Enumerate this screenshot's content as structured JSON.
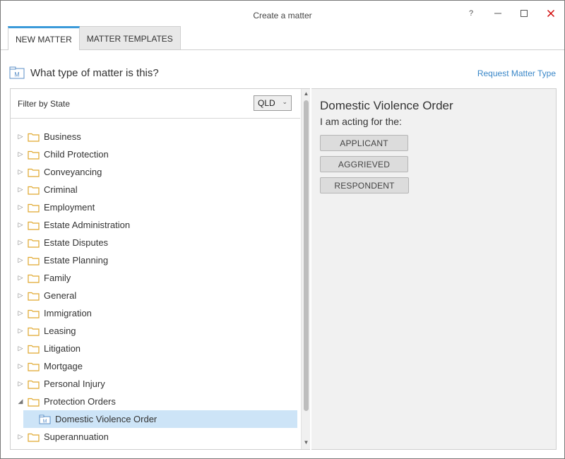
{
  "window": {
    "title": "Create a matter",
    "help_label": "?",
    "minimize_label": "–",
    "maximize_label": "☐",
    "close_label": "✕"
  },
  "tabs": [
    {
      "label": "NEW MATTER",
      "active": true
    },
    {
      "label": "MATTER TEMPLATES",
      "active": false
    }
  ],
  "heading": {
    "text": "What type of matter is this?",
    "icon": "matter-doc-icon",
    "request_link": "Request Matter Type"
  },
  "filter": {
    "label": "Filter by State",
    "state_value": "QLD"
  },
  "tree": [
    {
      "label": "Business",
      "expanded": false
    },
    {
      "label": "Child Protection",
      "expanded": false
    },
    {
      "label": "Conveyancing",
      "expanded": false
    },
    {
      "label": "Criminal",
      "expanded": false
    },
    {
      "label": "Employment",
      "expanded": false
    },
    {
      "label": "Estate Administration",
      "expanded": false
    },
    {
      "label": "Estate Disputes",
      "expanded": false
    },
    {
      "label": "Estate Planning",
      "expanded": false
    },
    {
      "label": "Family",
      "expanded": false
    },
    {
      "label": "General",
      "expanded": false
    },
    {
      "label": "Immigration",
      "expanded": false
    },
    {
      "label": "Leasing",
      "expanded": false
    },
    {
      "label": "Litigation",
      "expanded": false
    },
    {
      "label": "Mortgage",
      "expanded": false
    },
    {
      "label": "Personal Injury",
      "expanded": false
    },
    {
      "label": "Protection Orders",
      "expanded": true
    },
    {
      "label": "Domestic Violence Order",
      "child": true,
      "selected": true
    },
    {
      "label": "Superannuation",
      "expanded": false
    }
  ],
  "detail": {
    "title": "Domestic Violence Order",
    "subtitle": "I am acting for the:",
    "roles": [
      "APPLICANT",
      "AGGRIEVED",
      "RESPONDENT"
    ]
  },
  "colors": {
    "accent": "#3b9ad9",
    "link": "#3a87c8",
    "folder": "#f0c14b",
    "selected_row": "#cde4f7",
    "close": "#d00000"
  }
}
